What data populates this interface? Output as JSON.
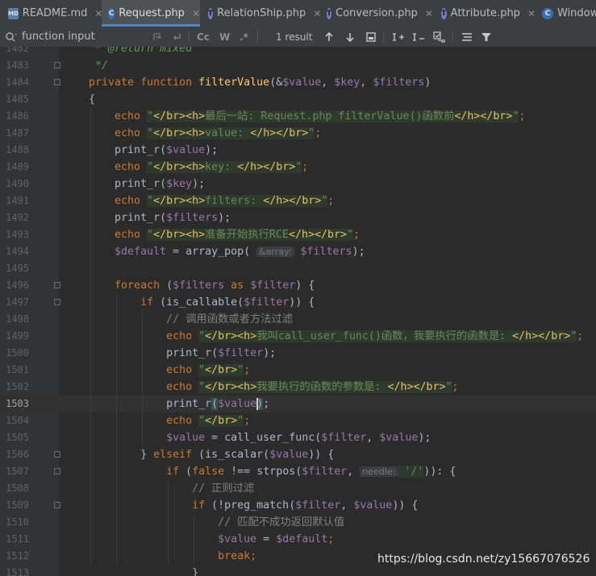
{
  "tabs": [
    {
      "label": "README.md",
      "icon": "markdown-file-icon",
      "active": false
    },
    {
      "label": "Request.php",
      "icon": "php-class-icon",
      "active": true
    },
    {
      "label": "RelationShip.php",
      "icon": "php-trait-icon",
      "active": false
    },
    {
      "label": "Conversion.php",
      "icon": "php-trait-icon",
      "active": false
    },
    {
      "label": "Attribute.php",
      "icon": "php-trait-icon",
      "active": false
    },
    {
      "label": "Window",
      "icon": "php-class-icon",
      "active": false
    }
  ],
  "search": {
    "value": "function input",
    "result_count": "1 result",
    "match_case": "Cc",
    "words": "W",
    "regex": ".*"
  },
  "editor": {
    "current_line": 1503,
    "lines": [
      {
        "n": "1482"
      },
      {
        "n": "1483"
      },
      {
        "n": "1484"
      },
      {
        "n": "1485"
      },
      {
        "n": "1486"
      },
      {
        "n": "1487"
      },
      {
        "n": "1488"
      },
      {
        "n": "1489"
      },
      {
        "n": "1490"
      },
      {
        "n": "1491"
      },
      {
        "n": "1492"
      },
      {
        "n": "1493"
      },
      {
        "n": "1494"
      },
      {
        "n": "1495"
      },
      {
        "n": "1496"
      },
      {
        "n": "1497"
      },
      {
        "n": "1498"
      },
      {
        "n": "1499"
      },
      {
        "n": "1500"
      },
      {
        "n": "1501"
      },
      {
        "n": "1502"
      },
      {
        "n": "1503"
      },
      {
        "n": "1504"
      },
      {
        "n": "1505"
      },
      {
        "n": "1506"
      },
      {
        "n": "1507"
      },
      {
        "n": "1508"
      },
      {
        "n": "1509"
      },
      {
        "n": "1510"
      },
      {
        "n": "1511"
      },
      {
        "n": "1512"
      },
      {
        "n": "1513"
      }
    ],
    "code": [
      [
        [
          "cmi",
          "     * @return mixed"
        ]
      ],
      [
        [
          "cmi",
          "     */"
        ]
      ],
      [
        [
          "kw",
          "    private function "
        ],
        [
          "fn",
          "filterValue"
        ],
        [
          "",
          "(&"
        ],
        [
          "var",
          "$value"
        ],
        [
          "",
          ", "
        ],
        [
          "var",
          "$key"
        ],
        [
          "",
          ", "
        ],
        [
          "var",
          "$filters"
        ],
        [
          "",
          ")"
        ]
      ],
      [
        [
          "",
          "    {"
        ]
      ],
      [
        [
          "kw",
          "        echo "
        ],
        [
          "str",
          "\""
        ],
        [
          "tag",
          "</br><h>"
        ],
        [
          "str",
          "最后一站: Request.php filterValue()函数前"
        ],
        [
          "tag",
          "</h></br>"
        ],
        [
          "str",
          "\""
        ],
        [
          "kw",
          ";"
        ]
      ],
      [
        [
          "kw",
          "        echo "
        ],
        [
          "str",
          "\""
        ],
        [
          "tag",
          "</br><h>"
        ],
        [
          "str",
          "value: "
        ],
        [
          "tag",
          "</h></br>"
        ],
        [
          "str",
          "\""
        ],
        [
          "kw",
          ";"
        ]
      ],
      [
        [
          "",
          "        print_r("
        ],
        [
          "var",
          "$value"
        ],
        [
          "",
          ");"
        ]
      ],
      [
        [
          "kw",
          "        echo "
        ],
        [
          "str",
          "\""
        ],
        [
          "tag",
          "</br><h>"
        ],
        [
          "str",
          "key: "
        ],
        [
          "tag",
          "</h></br>"
        ],
        [
          "str",
          "\""
        ],
        [
          "kw",
          ";"
        ]
      ],
      [
        [
          "",
          "        print_r("
        ],
        [
          "var",
          "$key"
        ],
        [
          "",
          ");"
        ]
      ],
      [
        [
          "kw",
          "        echo "
        ],
        [
          "str",
          "\""
        ],
        [
          "tag",
          "</br><h>"
        ],
        [
          "str",
          "filters: "
        ],
        [
          "tag",
          "</h></br>"
        ],
        [
          "str",
          "\""
        ],
        [
          "kw",
          ";"
        ]
      ],
      [
        [
          "",
          "        print_r("
        ],
        [
          "var",
          "$filters"
        ],
        [
          "",
          ");"
        ]
      ],
      [
        [
          "kw",
          "        echo "
        ],
        [
          "str",
          "\""
        ],
        [
          "tag",
          "</br><h>"
        ],
        [
          "str",
          "准备开始执行RCE"
        ],
        [
          "tag",
          "</h></br>"
        ],
        [
          "str",
          "\""
        ],
        [
          "kw",
          ";"
        ]
      ],
      [
        [
          "var",
          "        $default"
        ],
        [
          "",
          " = array_pop( "
        ],
        [
          "hint",
          "&array:"
        ],
        [
          "",
          " "
        ],
        [
          "var",
          "$filters"
        ],
        [
          "",
          ");"
        ]
      ],
      [
        [
          "",
          ""
        ]
      ],
      [
        [
          "kw",
          "        foreach "
        ],
        [
          "",
          "("
        ],
        [
          "var",
          "$filters"
        ],
        [
          "kw",
          " as "
        ],
        [
          "var",
          "$filter"
        ],
        [
          "",
          ") {"
        ]
      ],
      [
        [
          "kw",
          "            if "
        ],
        [
          "",
          "(is_callable("
        ],
        [
          "var",
          "$filter"
        ],
        [
          "",
          ")) {"
        ]
      ],
      [
        [
          "cm",
          "                // 调用函数或者方法过滤"
        ]
      ],
      [
        [
          "kw",
          "                echo "
        ],
        [
          "str",
          "\""
        ],
        [
          "tag",
          "</br><h>"
        ],
        [
          "str",
          "我叫call_user_func()函数，我要执行的函数是: "
        ],
        [
          "tag",
          "</h></br>"
        ],
        [
          "str",
          "\""
        ],
        [
          "kw",
          ";"
        ]
      ],
      [
        [
          "",
          "                print_r("
        ],
        [
          "var",
          "$filter"
        ],
        [
          "",
          ");"
        ]
      ],
      [
        [
          "kw",
          "                echo "
        ],
        [
          "str",
          "\""
        ],
        [
          "tag",
          "</br>"
        ],
        [
          "str",
          "\""
        ],
        [
          "kw",
          ";"
        ]
      ],
      [
        [
          "kw",
          "                echo "
        ],
        [
          "str",
          "\""
        ],
        [
          "tag",
          "</br><h>"
        ],
        [
          "str",
          "我要执行的函数的参数是: "
        ],
        [
          "tag",
          "</h></br>"
        ],
        [
          "str",
          "\""
        ],
        [
          "kw",
          ";"
        ]
      ],
      [
        [
          "",
          "                print_r"
        ],
        [
          "bracket",
          "("
        ],
        [
          "var",
          "$value"
        ],
        [
          "caretb",
          ")"
        ],
        [
          "",
          ";"
        ]
      ],
      [
        [
          "kw",
          "                echo "
        ],
        [
          "str",
          "\""
        ],
        [
          "tag",
          "</br>"
        ],
        [
          "str",
          "\""
        ],
        [
          "kw",
          ";"
        ]
      ],
      [
        [
          "var",
          "                $value"
        ],
        [
          "",
          " = call_user_func("
        ],
        [
          "var",
          "$filter"
        ],
        [
          "",
          ", "
        ],
        [
          "var",
          "$value"
        ],
        [
          "",
          ");"
        ]
      ],
      [
        [
          "",
          "            } "
        ],
        [
          "kw",
          "elseif "
        ],
        [
          "",
          "(is_scalar("
        ],
        [
          "var",
          "$value"
        ],
        [
          "",
          ")) {"
        ]
      ],
      [
        [
          "kw",
          "                if "
        ],
        [
          "",
          "("
        ],
        [
          "kw",
          "false "
        ],
        [
          "",
          "!== strpos("
        ],
        [
          "var",
          "$filter"
        ],
        [
          "",
          ", "
        ],
        [
          "hint",
          "needle:"
        ],
        [
          "str",
          " '/'"
        ],
        [
          "",
          "))"
        ],
        [
          "",
          ": {"
        ]
      ],
      [
        [
          "cm",
          "                    // 正则过滤"
        ]
      ],
      [
        [
          "kw",
          "                    if "
        ],
        [
          "",
          "(!preg_match("
        ],
        [
          "var",
          "$filter"
        ],
        [
          "",
          ", "
        ],
        [
          "var",
          "$value"
        ],
        [
          "",
          ")) {"
        ]
      ],
      [
        [
          "cm",
          "                        // 匹配不成功返回默认值"
        ]
      ],
      [
        [
          "var",
          "                        $value"
        ],
        [
          "",
          " = "
        ],
        [
          "var",
          "$default"
        ],
        [
          "kw",
          ";"
        ]
      ],
      [
        [
          "kw",
          "                        break;"
        ]
      ],
      [
        [
          "",
          "                    }"
        ]
      ]
    ]
  },
  "watermark": "https://blog.csdn.net/zy15667076526"
}
